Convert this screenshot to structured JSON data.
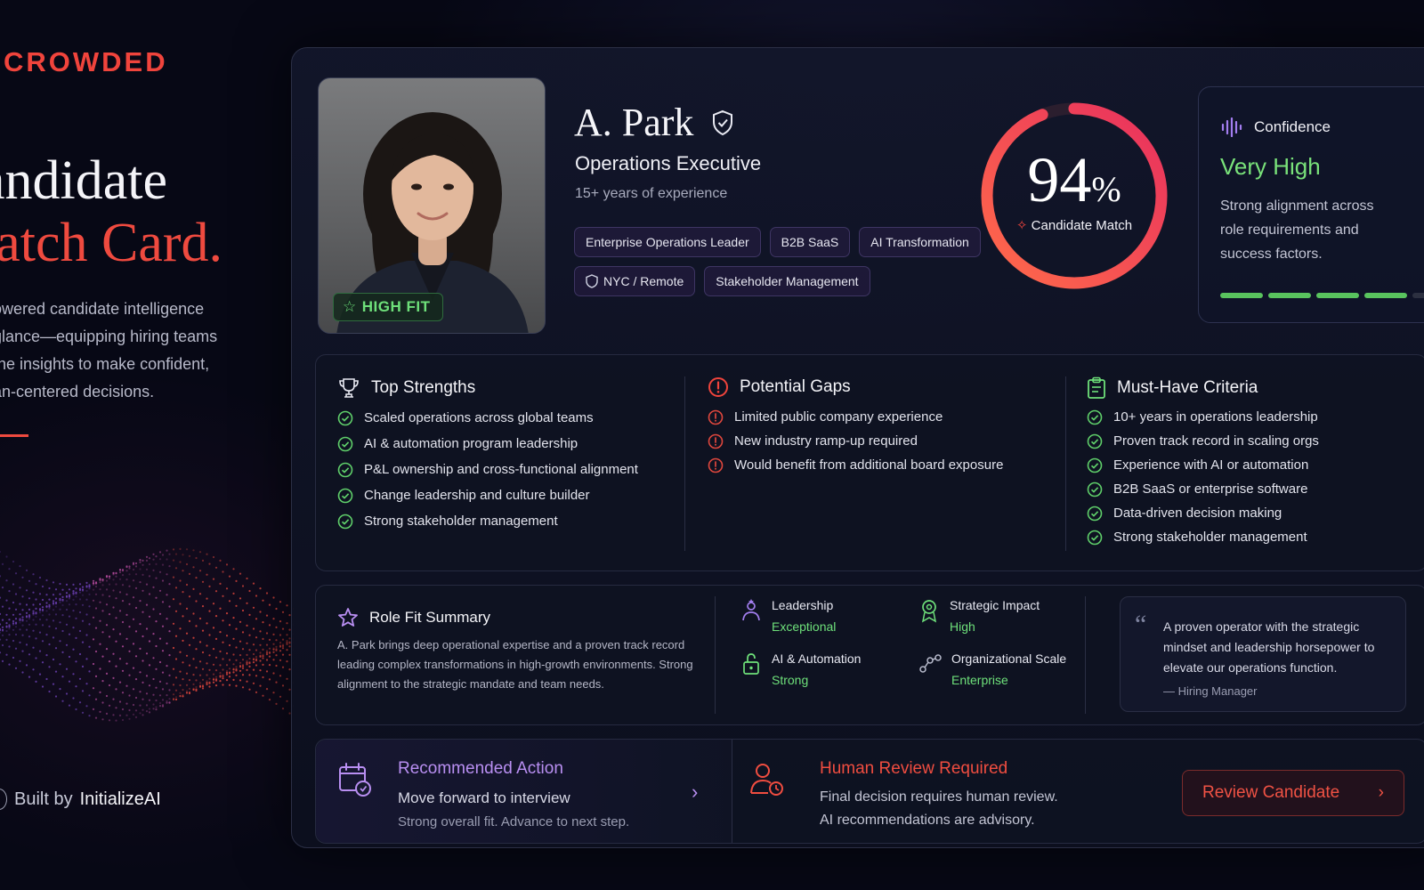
{
  "brand": "CROWDED",
  "hero": {
    "title_line1": "andidate",
    "title_line2": "latch Card.",
    "copy": [
      "owered candidate intelligence",
      "glance—equipping hiring teams",
      "the insights to make confident,",
      "an-centered decisions."
    ],
    "built_prefix": "Built by",
    "built_brand": "InitializeAI"
  },
  "candidate": {
    "name": "A. Park",
    "title": "Operations Executive",
    "experience": "15+ years of experience",
    "fit_badge": "HIGH FIT",
    "tags": [
      {
        "label": "Enterprise Operations Leader",
        "icon": ""
      },
      {
        "label": "B2B SaaS",
        "icon": ""
      },
      {
        "label": "AI Transformation",
        "icon": ""
      },
      {
        "label": "NYC / Remote",
        "icon": "shield-icon"
      },
      {
        "label": "Stakeholder Management",
        "icon": ""
      }
    ]
  },
  "match": {
    "value": "94",
    "unit": "%",
    "label": "Candidate Match",
    "fraction": 0.94
  },
  "confidence": {
    "heading": "Confidence",
    "level": "Very High",
    "description": "Strong alignment across role requirements and success factors.",
    "segments_filled": 4,
    "segments_total": 5
  },
  "strengths": {
    "heading": "Top Strengths",
    "items": [
      "Scaled operations across global teams",
      "AI & automation program leadership",
      "P&L ownership and cross-functional alignment",
      "Change leadership and culture builder",
      "Strong stakeholder management"
    ]
  },
  "gaps": {
    "heading": "Potential Gaps",
    "items": [
      "Limited public company experience",
      "New industry ramp-up required",
      "Would benefit from additional board exposure"
    ]
  },
  "must_have": {
    "heading": "Must-Have Criteria",
    "items": [
      "10+ years in operations leadership",
      "Proven track record in scaling orgs",
      "Experience with AI or automation",
      "B2B SaaS or enterprise software",
      "Data-driven decision making",
      "Strong stakeholder management"
    ]
  },
  "role_fit": {
    "heading": "Role Fit Summary",
    "body": "A. Park brings deep operational expertise and a proven track record leading complex transformations in high-growth environments. Strong alignment to the strategic mandate and team needs.",
    "metrics": [
      {
        "label": "Leadership",
        "value": "Exceptional",
        "icon": "leader-icon"
      },
      {
        "label": "Strategic Impact",
        "value": "High",
        "icon": "target-pin-icon"
      },
      {
        "label": "AI & Automation",
        "value": "Strong",
        "icon": "lock-icon"
      },
      {
        "label": "Organizational Scale",
        "value": "Enterprise",
        "icon": "network-icon"
      }
    ],
    "quote": "A proven operator with the strategic mindset and leadership horsepower to elevate our operations function.",
    "quote_author": "— Hiring Manager"
  },
  "action": {
    "title": "Recommended Action",
    "main": "Move forward to interview",
    "sub": "Strong overall fit. Advance to next step.",
    "review_title": "Human Review Required",
    "review_main": "Final decision requires human review.",
    "review_sub": "AI recommendations are advisory.",
    "button": "Review Candidate"
  },
  "colors": {
    "accent_red": "#f0443c",
    "accent_green": "#6ee07a",
    "accent_purple": "#b98ff2",
    "background": "#070815"
  }
}
